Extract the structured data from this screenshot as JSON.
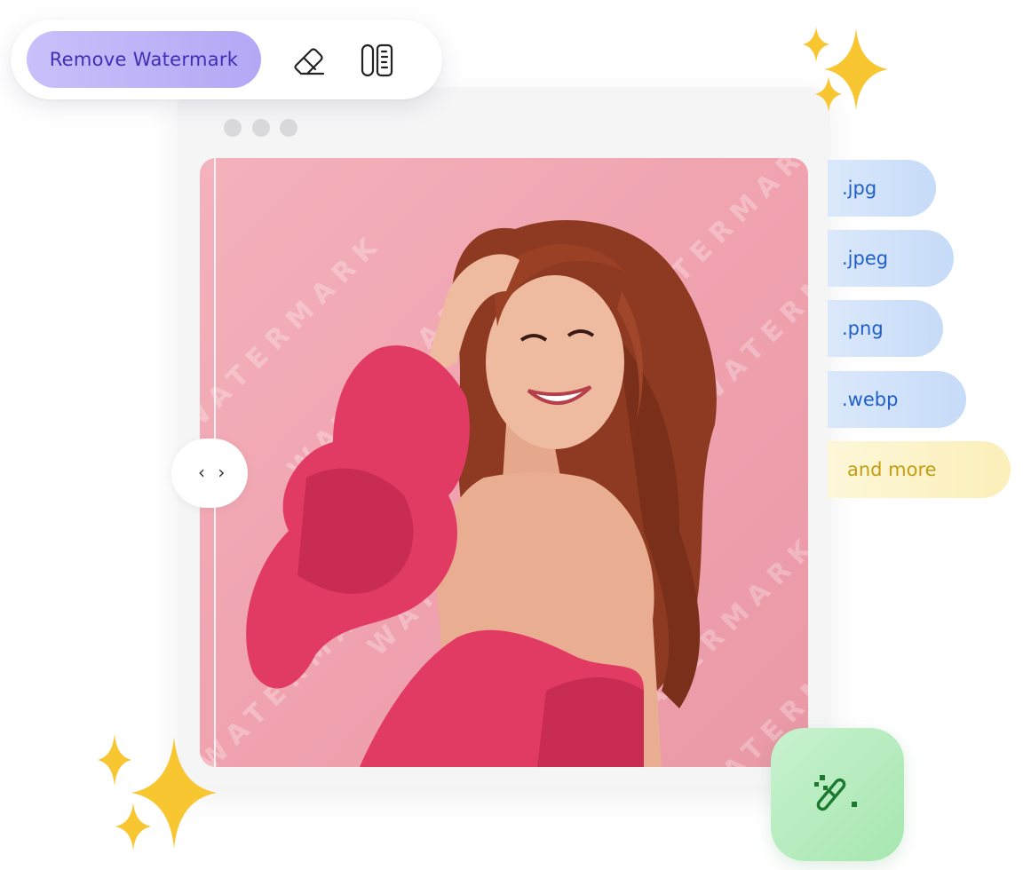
{
  "toolbar": {
    "remove_watermark_label": "Remove Watermark",
    "eraser_icon": "eraser-icon",
    "compare_icon": "compare-icon"
  },
  "window": {
    "dots": [
      "dot",
      "dot",
      "dot"
    ]
  },
  "photo": {
    "watermark_text": "WATERMARK",
    "split_handle_glyph": "‹ ›"
  },
  "formats": [
    {
      "label": ".jpg"
    },
    {
      "label": ".jpeg"
    },
    {
      "label": ".png"
    },
    {
      "label": ".webp"
    },
    {
      "label": "and more"
    }
  ],
  "colors": {
    "remove_button": "#b4a7f5",
    "remove_button_text": "#3f2fb4",
    "format_chip_blue": "#c6dbf8",
    "format_chip_text": "#1f5fc8",
    "more_chip": "#fbefb9",
    "more_chip_text": "#c59d12",
    "magic_button": "#a6e6b0",
    "photo_background": "#f0a4b0",
    "sparkle": "#f7c630"
  },
  "magic_button_icon": "magic-wand-icon"
}
